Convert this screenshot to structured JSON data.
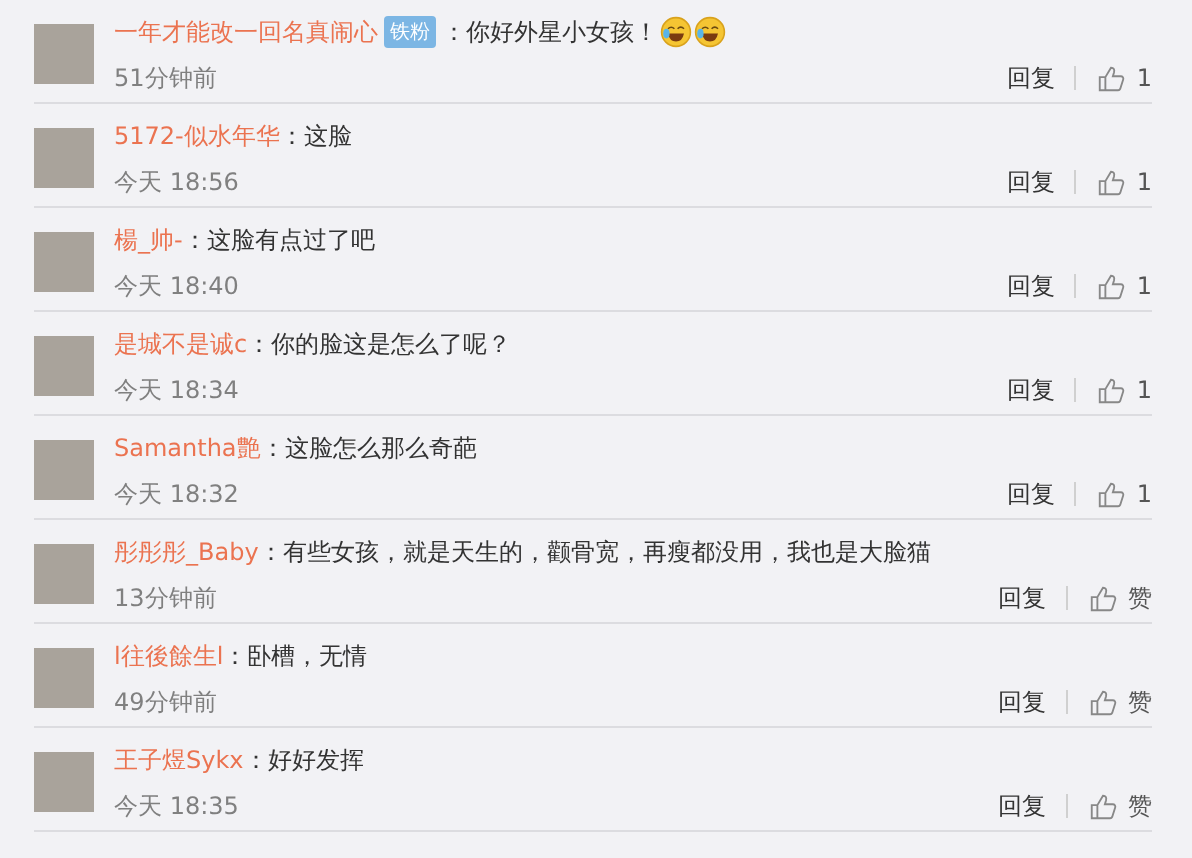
{
  "comments": [
    {
      "name": "一年才能改一回名真闹心",
      "badge": "铁粉",
      "text": "：你好外星小女孩！",
      "emojis": [
        {
          "kind": "laugh-cry"
        },
        {
          "kind": "laugh-cry"
        }
      ],
      "time": "51分钟前",
      "reply": "回复",
      "like": "1"
    },
    {
      "name": "5172-似水年华",
      "text": "：这脸",
      "time": "今天 18:56",
      "reply": "回复",
      "like": "1"
    },
    {
      "name": "楊_帅-",
      "text": "：这脸有点过了吧",
      "time": "今天 18:40",
      "reply": "回复",
      "like": "1"
    },
    {
      "name": "是城不是诚c",
      "text": "：你的脸这是怎么了呢？",
      "time": "今天 18:34",
      "reply": "回复",
      "like": "1"
    },
    {
      "name": "Samantha艶",
      "text": "：这脸怎么那么奇葩",
      "time": "今天 18:32",
      "reply": "回复",
      "like": "1"
    },
    {
      "name": "彤彤彤_Baby",
      "text": "：有些女孩，就是天生的，颧骨宽，再瘦都没用，我也是大脸猫",
      "time": "13分钟前",
      "reply": "回复",
      "like": "赞"
    },
    {
      "name": "l往後餘生l",
      "text": "：卧槽，无情",
      "time": "49分钟前",
      "reply": "回复",
      "like": "赞"
    },
    {
      "name": "王子煜Sykx",
      "text": "：好好发挥",
      "time": "今天 18:35",
      "reply": "回复",
      "like": "赞"
    }
  ]
}
